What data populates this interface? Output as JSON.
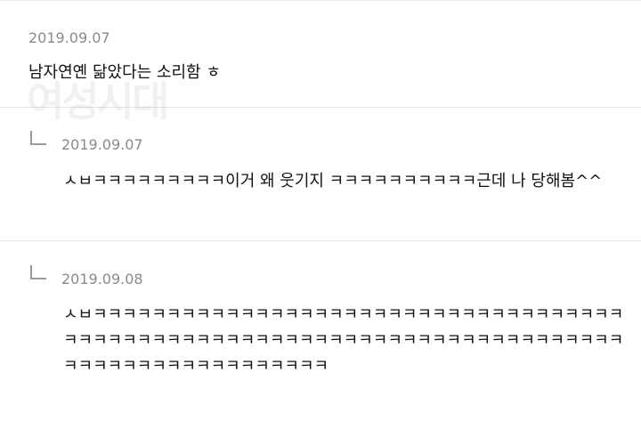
{
  "comments": [
    {
      "date": "2019.09.07",
      "text": "남자연옌 닮았다는 소리함 ㅎ"
    },
    {
      "date": "2019.09.07",
      "text": "ㅅㅂㅋㅋㅋㅋㅋㅋㅋㅋㅋ이거 왜 웃기지 ㅋㅋㅋㅋㅋㅋㅋㅋㅋㅋ근데 나 당해봄^^"
    },
    {
      "date": "2019.09.08",
      "text": "ㅅㅂㅋㅋㅋㅋㅋㅋㅋㅋㅋㅋㅋㅋㅋㅋㅋㅋㅋㅋㅋㅋㅋㅋㅋㅋㅋㅋㅋㅋㅋㅋㅋㅋㅋㅋㅋㅋㅋㅋㅋㅋㅋㅋㅋㅋㅋㅋㅋㅋㅋㅋㅋㅋㅋㅋㅋㅋㅋㅋㅋㅋㅋㅋㅋㅋㅋㅋㅋㅋㅋㅋㅋㅋㅋㅋㅋㅋㅋㅋㅋㅋㅋㅋㅋㅋㅋㅋㅋㅋㅋㅋㅋㅋ"
    }
  ],
  "watermark_text": "여성시대",
  "icons": {
    "reply": "reply-arrow-icon"
  },
  "colors": {
    "date": "#8a8a8a",
    "text": "#111111",
    "divider": "#e6e6e6"
  }
}
